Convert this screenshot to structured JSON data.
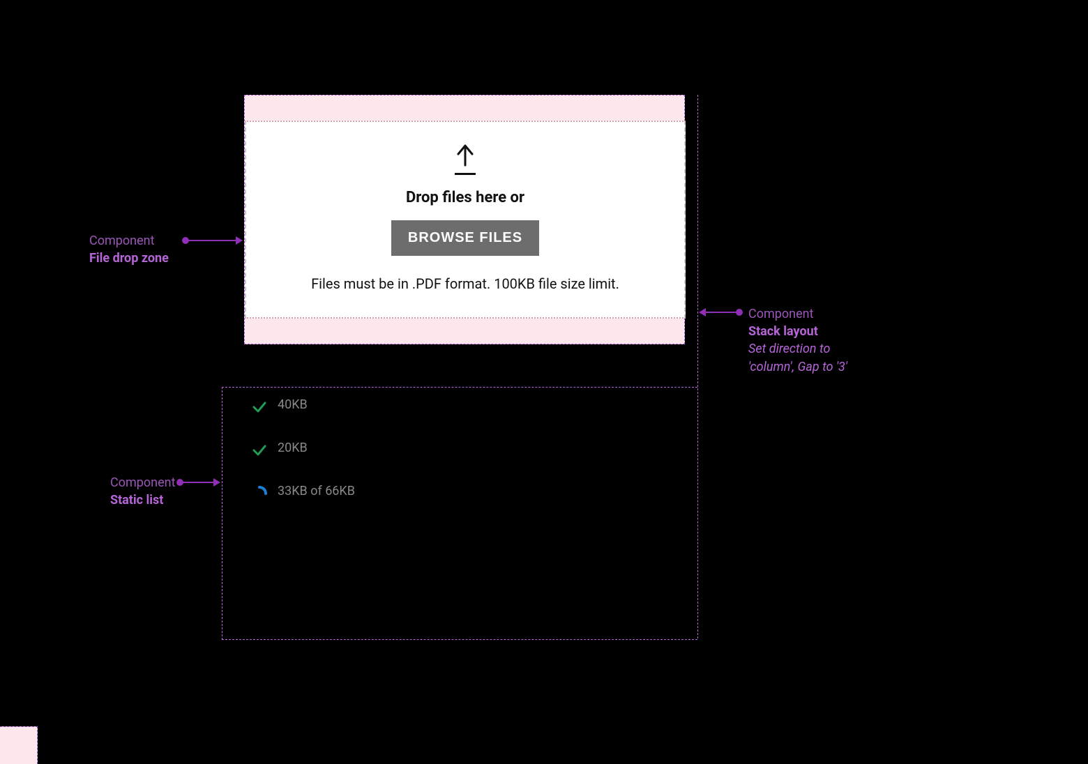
{
  "annotations": {
    "dropzone": {
      "label": "Component",
      "name": "File drop zone"
    },
    "staticlist": {
      "label": "Component",
      "name": "Static list"
    },
    "stacklayout": {
      "label": "Component",
      "name": "Stack layout",
      "detail1": "Set direction to",
      "detail2": "'column', Gap to '3'"
    }
  },
  "dropzone": {
    "prompt": "Drop files here or",
    "button": "BROWSE FILES",
    "hint": "Files must be in .PDF format. 100KB file size limit."
  },
  "files": [
    {
      "status": "done",
      "size": "40KB"
    },
    {
      "status": "done",
      "size": "20KB"
    },
    {
      "status": "uploading",
      "size": "33KB of 66KB"
    }
  ]
}
